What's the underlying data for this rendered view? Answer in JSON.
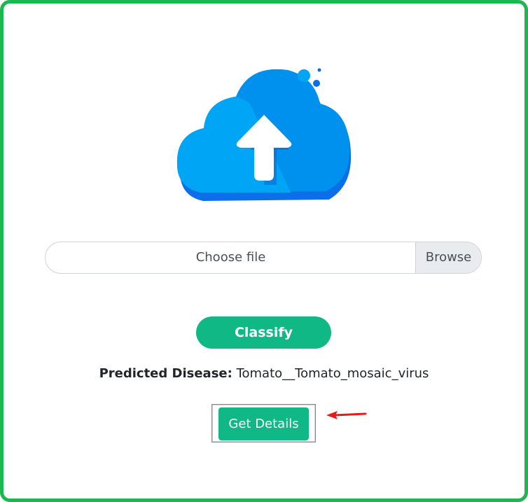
{
  "upload": {
    "icon": "cloud-upload-icon",
    "file_label": "Choose file",
    "browse_label": "Browse"
  },
  "actions": {
    "classify_label": "Classify",
    "details_label": "Get Details"
  },
  "result": {
    "label": "Predicted Disease:",
    "value": "Tomato__Tomato_mosaic_virus"
  },
  "annotation": {
    "icon": "red-arrow-icon",
    "color": "#e31b1b"
  },
  "colors": {
    "frame": "#1ab94f",
    "button": "#10b886",
    "cloud_light": "#00a0f0",
    "cloud_dark": "#0a6fe8"
  }
}
